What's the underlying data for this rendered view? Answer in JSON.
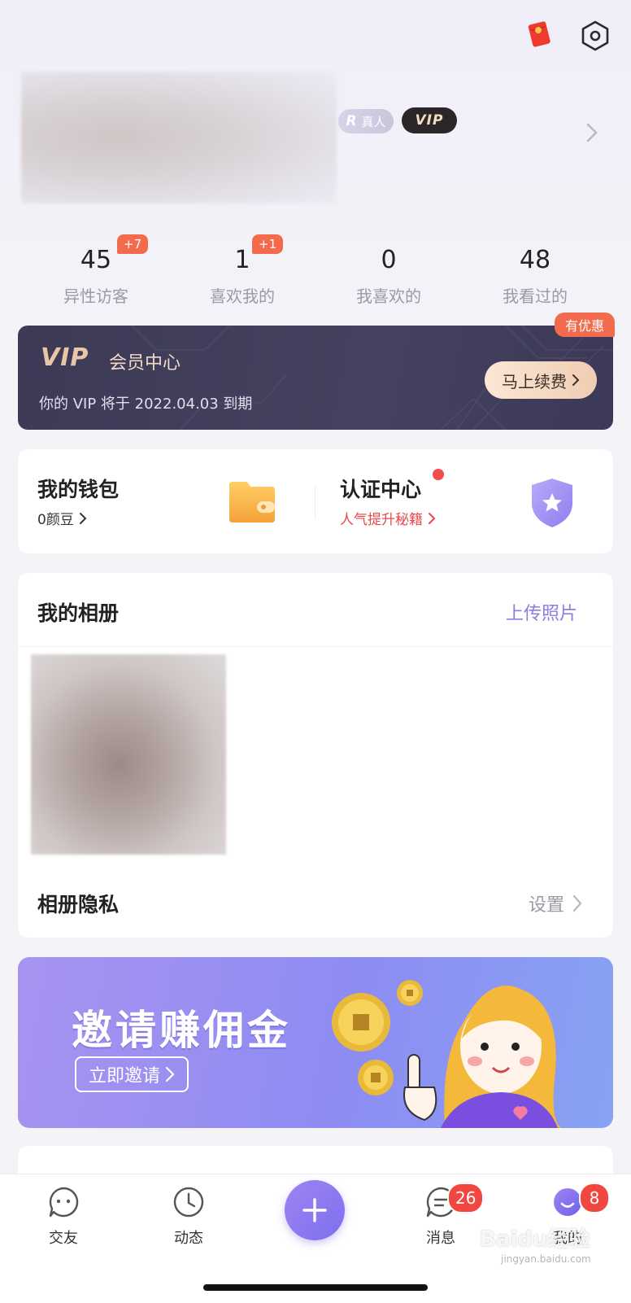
{
  "profile": {
    "badge_real_prefix": "R",
    "badge_real": "真人",
    "badge_vip": "VIP"
  },
  "stats": [
    {
      "value": "45",
      "label": "异性访客",
      "increment": "+7"
    },
    {
      "value": "1",
      "label": "喜欢我的",
      "increment": "+1"
    },
    {
      "value": "0",
      "label": "我喜欢的",
      "increment": ""
    },
    {
      "value": "48",
      "label": "我看过的",
      "increment": ""
    }
  ],
  "vip": {
    "logo": "VIP",
    "title": "会员中心",
    "expire_text": "你的 VIP 将于 2022.04.03 到期",
    "renew_label": "马上续费",
    "promo": "有优惠"
  },
  "wallet": {
    "title": "我的钱包",
    "balance": "0颜豆"
  },
  "certification": {
    "title": "认证中心",
    "subtitle": "人气提升秘籍"
  },
  "album": {
    "title": "我的相册",
    "upload_label": "上传照片",
    "privacy_label": "相册隐私",
    "privacy_setting": "设置"
  },
  "invite": {
    "title": "邀请赚佣金",
    "button": "立即邀请"
  },
  "tabbar": {
    "items": [
      {
        "label": "交友",
        "badge": ""
      },
      {
        "label": "动态",
        "badge": ""
      },
      {
        "label": "消息",
        "badge": "26"
      },
      {
        "label": "我的",
        "badge": "8"
      }
    ]
  },
  "watermark": {
    "text": "Baidu经验",
    "sub": "jingyan.baidu.com"
  },
  "colors": {
    "accent": "#8a7ee0",
    "badge_red": "#f2473f",
    "increment_orange": "#f46a4d",
    "vip_dark": "#3c3a55"
  }
}
